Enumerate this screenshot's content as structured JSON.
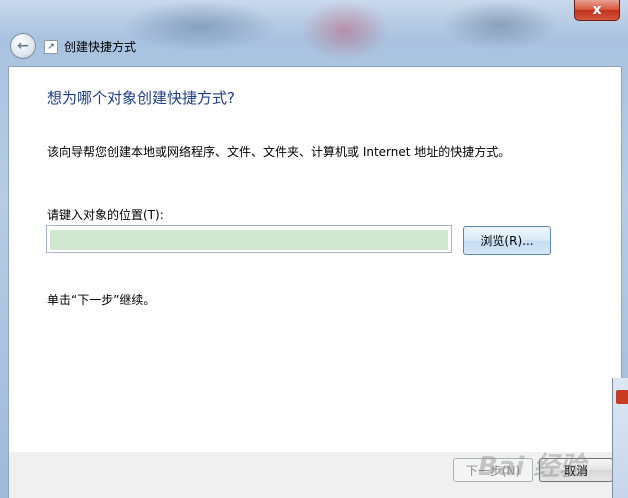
{
  "window": {
    "title": "创建快捷方式",
    "close_glyph": "x"
  },
  "content": {
    "heading": "想为哪个对象创建快捷方式?",
    "description": "该向导帮您创建本地或网络程序、文件、文件夹、计算机或 Internet 地址的快捷方式。",
    "location_label": "请键入对象的位置(T):",
    "location_value": "",
    "browse_label": "浏览(R)...",
    "hint": "单击“下一步”继续。"
  },
  "footer": {
    "next_label": "下一步(N)",
    "cancel_label": "取消"
  },
  "watermark": {
    "text": "Bai 经验"
  },
  "colors": {
    "heading": "#1e3f8a",
    "input_fill": "#cfe8cf",
    "close_button": "#c2331b"
  }
}
